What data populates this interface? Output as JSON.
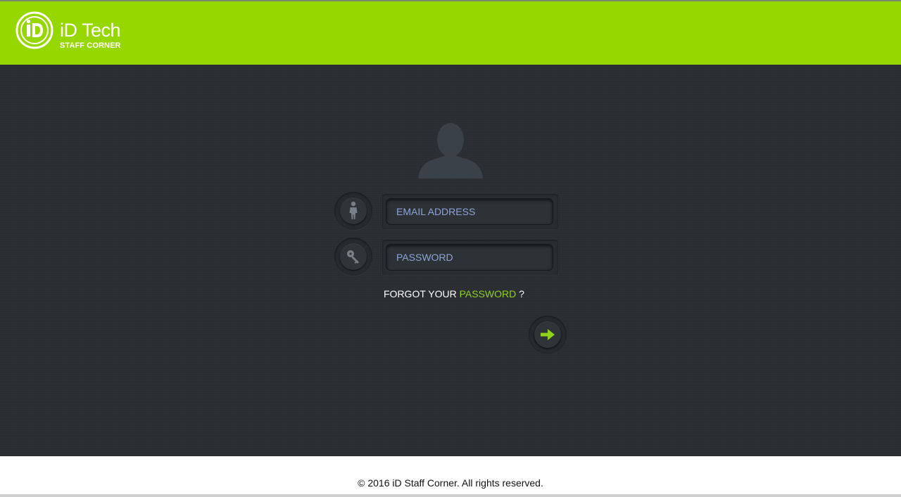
{
  "header": {
    "brand_title": "iD Tech",
    "brand_subtitle": "STAFF CORNER",
    "brand_color": "#97d700"
  },
  "login": {
    "avatar_icon": "user-silhouette-icon",
    "email": {
      "icon": "person-icon",
      "placeholder": "EMAIL ADDRESS",
      "value": ""
    },
    "password": {
      "icon": "key-icon",
      "placeholder": "PASSWORD",
      "value": ""
    },
    "forgot": {
      "prefix": "FORGOT YOUR ",
      "link": "PASSWORD",
      "suffix": " ?"
    },
    "submit_icon": "arrow-right-icon",
    "accent_color": "#8fd11c",
    "background_color": "#2b2f33"
  },
  "footer": {
    "copyright": "© 2016 iD Staff Corner. All rights reserved."
  }
}
